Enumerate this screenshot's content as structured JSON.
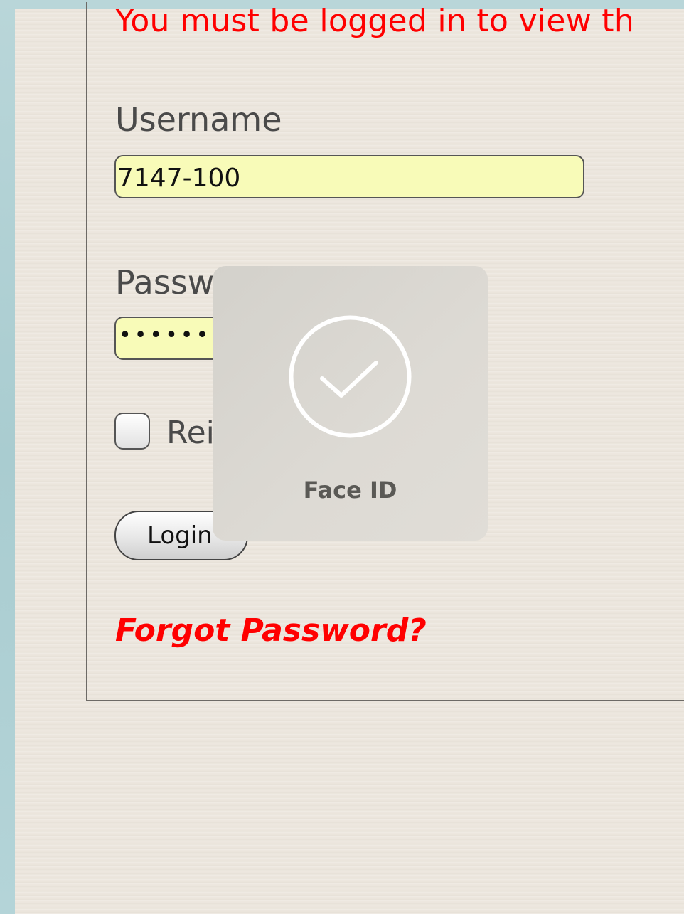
{
  "notice": {
    "text": "You must be logged in to view th"
  },
  "form": {
    "username_label": "Username",
    "username_value": "7147-100",
    "password_label": "Passw",
    "password_masked": "••••••",
    "remember_label": "Rei          rname",
    "login_label": "Login",
    "forgot_label": "Forgot Password?"
  },
  "faceid": {
    "label": "Face ID",
    "icon": "checkmark-circle-icon"
  },
  "colors": {
    "notice": "#ff0000",
    "input_background": "#f8fbb8",
    "paper": "#ece6dd"
  }
}
